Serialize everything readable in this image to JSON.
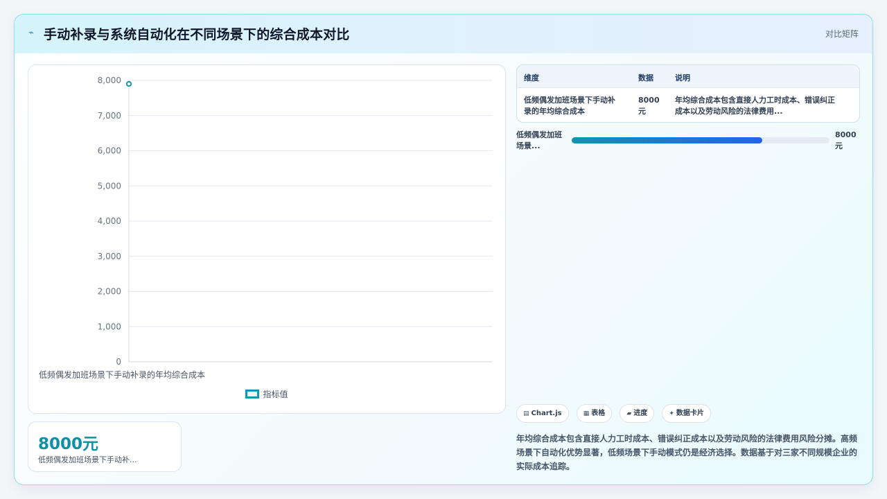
{
  "header": {
    "logo_icon": "sparkline-icon",
    "title": "手动补录与系统自动化在不同场景下的综合成本对比",
    "mode_label": "对比矩阵"
  },
  "chart_data": {
    "type": "line",
    "categories": [
      "低频偶发加班场景下手动补录的年均综合成本"
    ],
    "series": [
      {
        "name": "指标值",
        "values": [
          7900
        ],
        "color": "#1596ad"
      }
    ],
    "ylim": [
      0,
      8000
    ],
    "yticks": [
      0,
      1000,
      2000,
      3000,
      4000,
      5000,
      6000,
      7000,
      8000
    ],
    "ytick_labels": [
      "0",
      "1,000",
      "2,000",
      "3,000",
      "4,000",
      "5,000",
      "6,000",
      "7,000",
      "8,000"
    ],
    "grid": true,
    "legend_position": "bottom"
  },
  "stat": {
    "value": "8000元",
    "label": "低频偶发加班场景下手动补..."
  },
  "table": {
    "headers": [
      "维度",
      "数据",
      "说明"
    ],
    "rows": [
      {
        "dim": [
          "低频偶发加班场景下手动补",
          "录的年均综合成本"
        ],
        "value": [
          "8000",
          "元"
        ],
        "desc": [
          "年均综合成本包含直接人力工时成本、错误纠正",
          "成本以及劳动风险的法律费用..."
        ]
      }
    ]
  },
  "progress": {
    "label": [
      "低频偶发加班",
      "场景..."
    ],
    "value_text": [
      "8000",
      "元"
    ],
    "fraction": 0.74
  },
  "chips": [
    {
      "icon": "chart-icon",
      "glyph": "▤",
      "label": "Chart.js"
    },
    {
      "icon": "table-icon",
      "glyph": "▦",
      "label": "表格"
    },
    {
      "icon": "progress-icon",
      "glyph": "▰",
      "label": "进度"
    },
    {
      "icon": "sparkle-icon",
      "glyph": "✦",
      "label": "数据卡片"
    }
  ],
  "note": "年均综合成本包含直接人力工时成本、错误纠正成本以及劳动风险的法律费用风险分摊。高频场景下自动化优势显著，低频场景下手动模式仍是经济选择。数据基于对三家不同规模企业的实际成本追踪。"
}
